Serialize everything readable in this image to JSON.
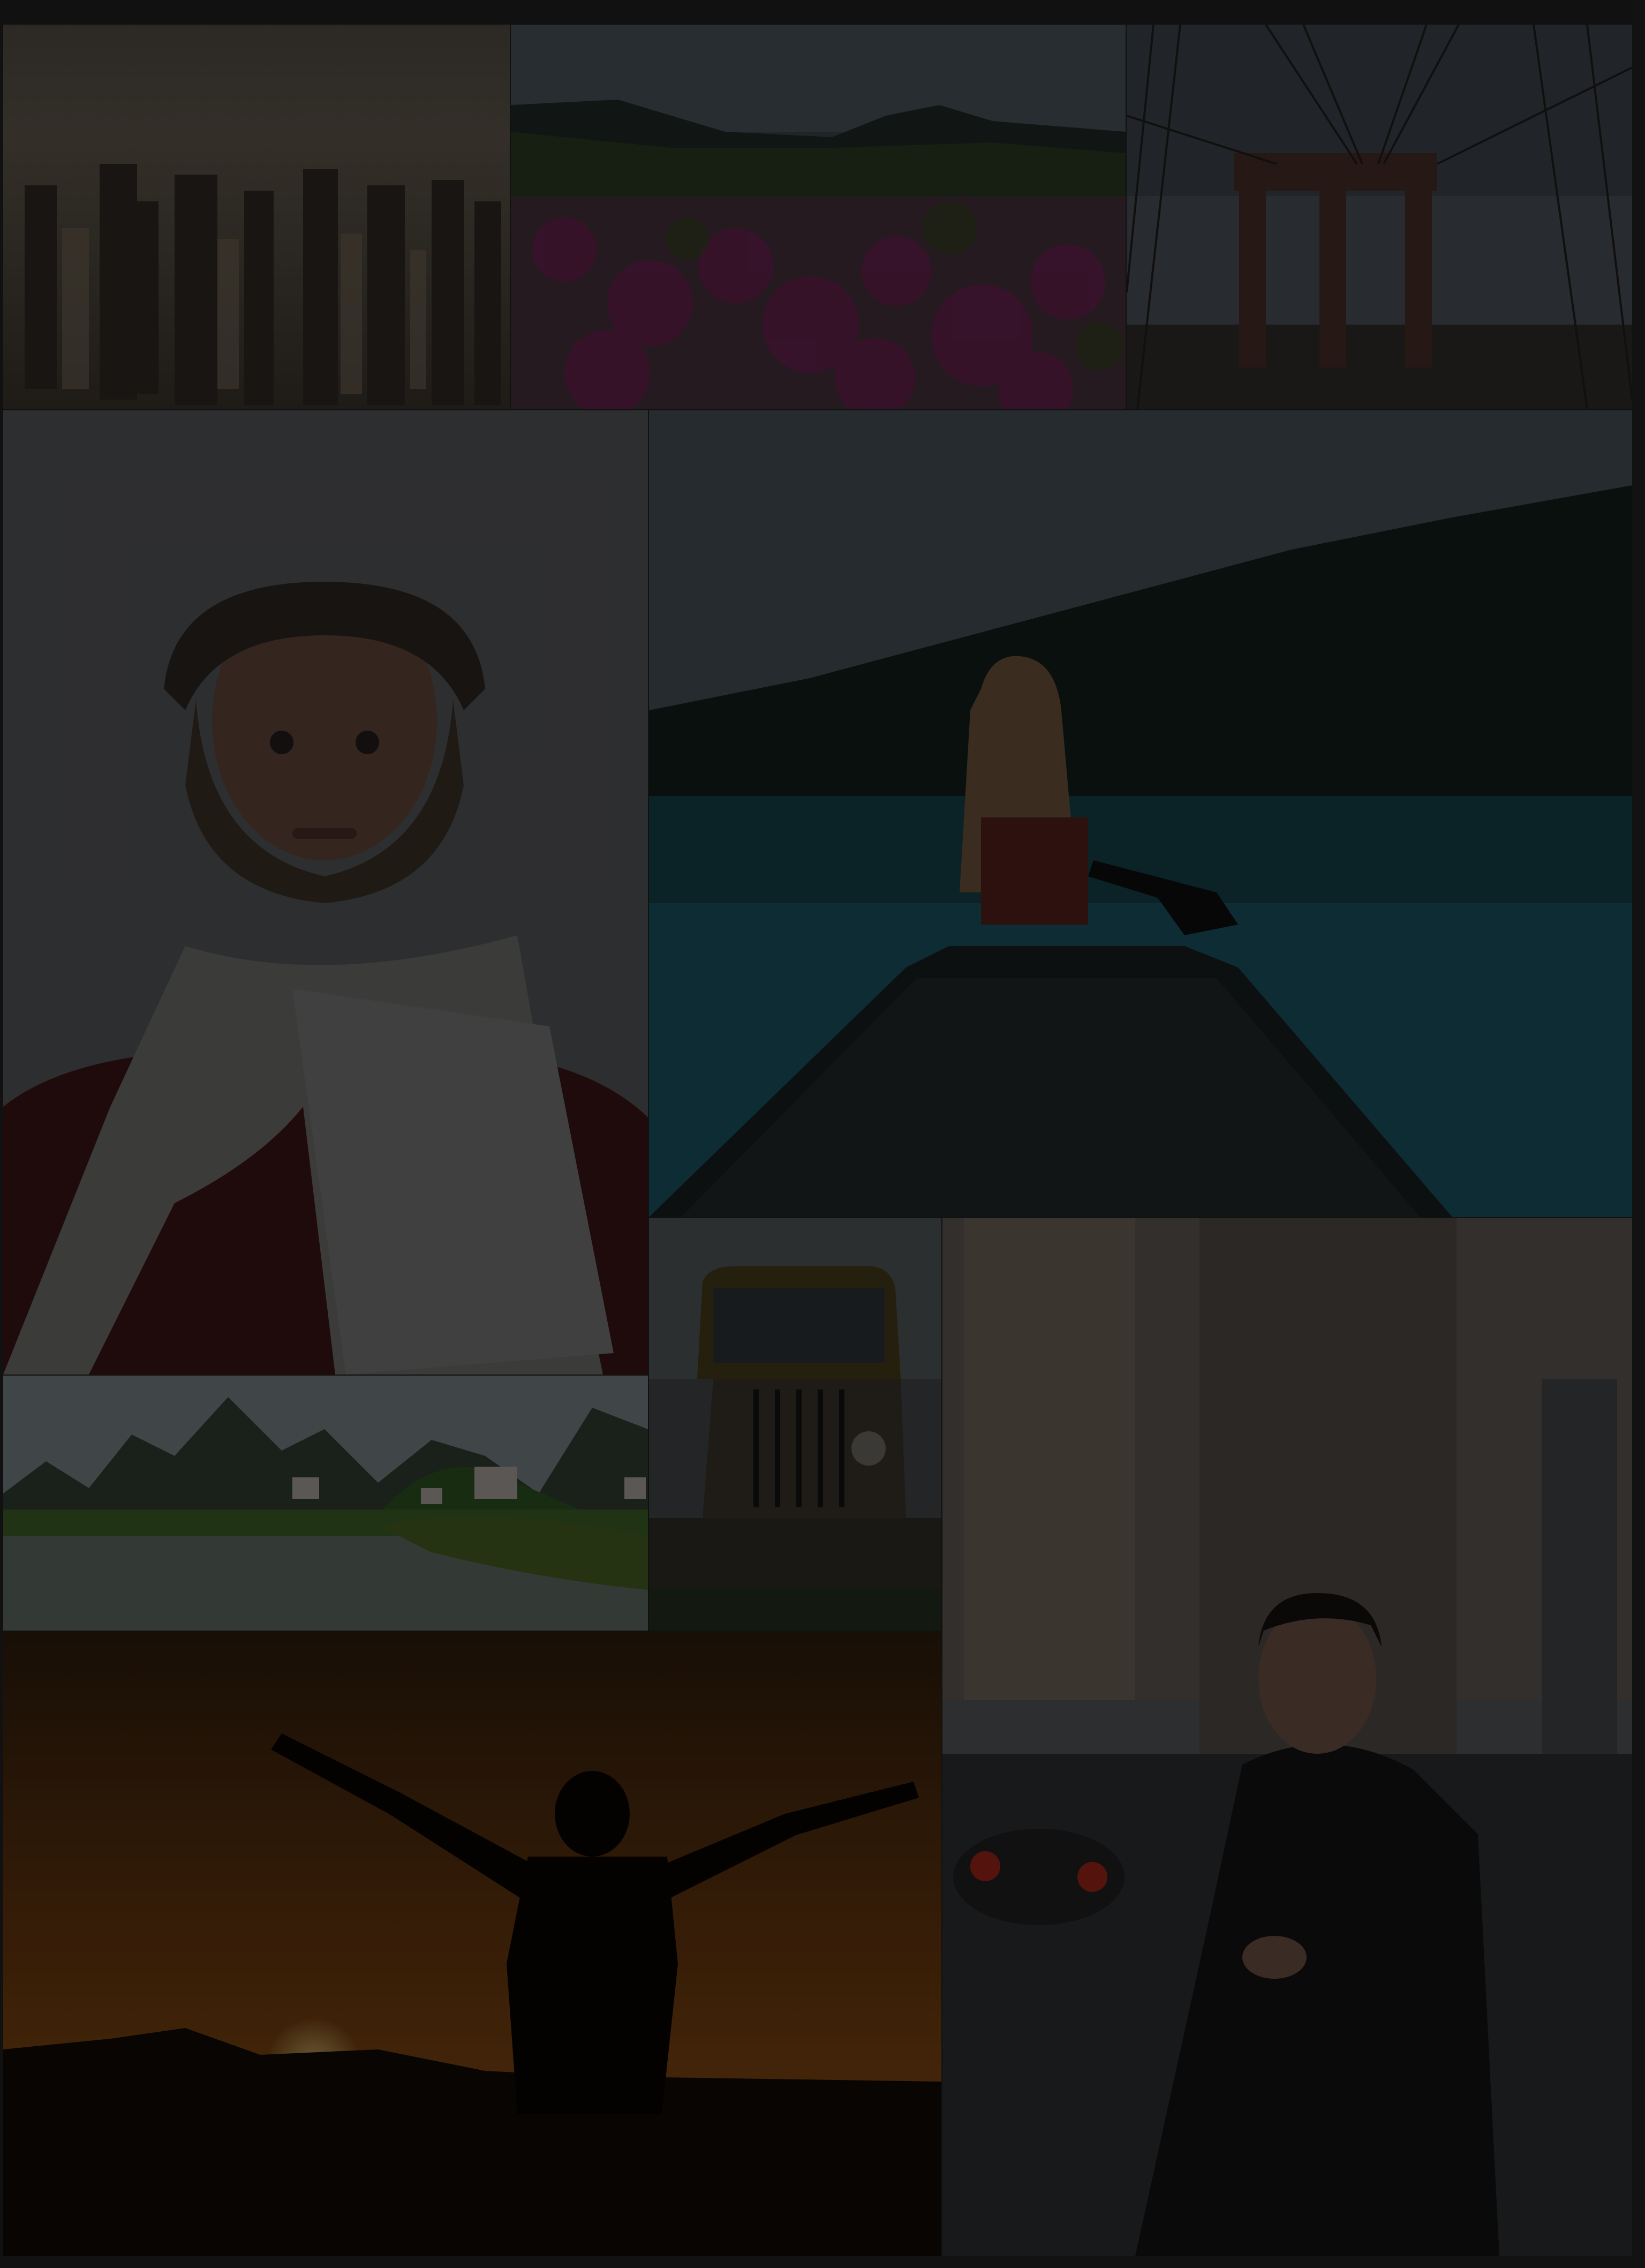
{
  "gallery": {
    "tiles": [
      {
        "name": "photo-city-aerial",
        "subject": "city-skyline"
      },
      {
        "name": "photo-flower-field",
        "subject": "mountain-meadow"
      },
      {
        "name": "photo-suspension-bridge",
        "subject": "bridge"
      },
      {
        "name": "photo-portrait-scarf",
        "subject": "portrait"
      },
      {
        "name": "photo-canoe-lake",
        "subject": "canoe"
      },
      {
        "name": "photo-river-mountains",
        "subject": "landscape"
      },
      {
        "name": "photo-rusty-truck",
        "subject": "vehicle"
      },
      {
        "name": "photo-man-street",
        "subject": "street-portrait"
      },
      {
        "name": "photo-sunset-silhouette",
        "subject": "silhouette"
      }
    ],
    "colors": {
      "background": "#2a2a2a",
      "overlay": "#000000"
    }
  }
}
